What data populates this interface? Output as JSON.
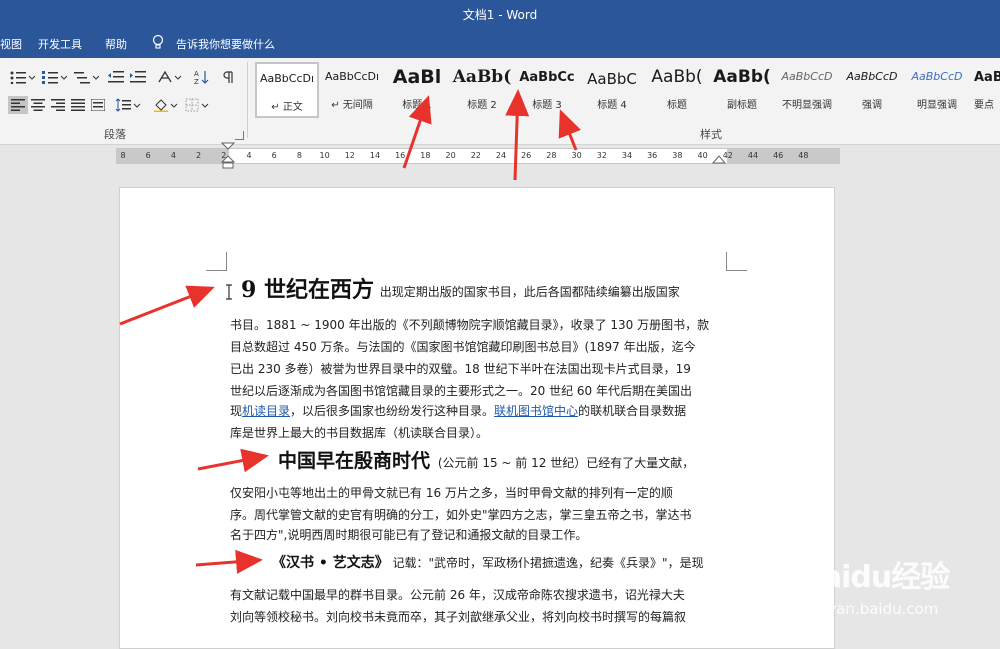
{
  "window": {
    "title": "文档1  -  Word"
  },
  "menu": {
    "tabs": [
      {
        "label": "视图"
      },
      {
        "label": "开发工具"
      },
      {
        "label": "帮助"
      },
      {
        "label": "告诉我你想要做什么"
      }
    ]
  },
  "ribbon": {
    "paragraph_group_label": "段落",
    "styles_group_label": "样式",
    "styles": [
      {
        "sample": "AaBbCcDı",
        "name": "↵ 正文",
        "selected": true
      },
      {
        "sample": "AaBbCcDı",
        "name": "↵ 无间隔"
      },
      {
        "sample": "AaBl",
        "name": "标题 1"
      },
      {
        "sample": "AaBb(",
        "name": "标题 2"
      },
      {
        "sample": "AaBbCc",
        "name": "标题 3"
      },
      {
        "sample": "AaBbC",
        "name": "标题 4"
      },
      {
        "sample": "AaBb(",
        "name": "标题"
      },
      {
        "sample": "AaBb(",
        "name": "副标题"
      },
      {
        "sample": "AaBbCcD",
        "name": "不明显强调"
      },
      {
        "sample": "AaBbCcD",
        "name": "强调"
      },
      {
        "sample": "AaBbCcD",
        "name": "明显强调"
      },
      {
        "sample": "AaBI",
        "name": "要点"
      }
    ]
  },
  "ruler": {
    "ticks": [
      "8",
      "6",
      "4",
      "2",
      "2",
      "4",
      "6",
      "8",
      "10",
      "12",
      "14",
      "16",
      "18",
      "20",
      "22",
      "24",
      "26",
      "28",
      "30",
      "32",
      "34",
      "36",
      "38",
      "40",
      "42",
      "44",
      "46",
      "48"
    ]
  },
  "document": {
    "paragraphs": [
      {
        "heading": "9 世纪在西方",
        "lines": [
          "出现定期出版的国家书目，此后各国都陆续编纂出版国家",
          "书目。1881 ~ 1900 年出版的《不列颠博物院字顺馆藏目录》，收录了 130 万册图书，款",
          "目总数超过 450 万条。与法国的《国家图书馆馆藏印刷图书总目》(1897 年出版，迄今",
          "已出 230 多卷）被誉为世界目录中的双璧。18 世纪下半叶在法国出现卡片式目录，19",
          "世纪以后逐渐成为各国图书馆馆藏目录的主要形式之一。20 世纪 60 年代后期在美国出",
          "库是世界上最大的书目数据库（机读联合目录）。"
        ],
        "line6_a": "现",
        "link1": "机读目录",
        "line6_b": "，以后很多国家也纷纷发行这种目录。",
        "link2": "联机图书馆中心",
        "line6_c": "的联机联合目录数据"
      },
      {
        "heading": "中国早在殷商时代",
        "lines": [
          "(公元前 15 ~ 前 12 世纪）已经有了大量文献，",
          "仅安阳小屯等地出土的甲骨文就已有 16 万片之多，当时甲骨文献的排列有一定的顺",
          "序。周代掌管文献的史官有明确的分工，如外史\"掌四方之志，掌三皇五帝之书，掌达书",
          "名于四方\",说明西周时期很可能已有了登记和通报文献的目录工作。"
        ]
      },
      {
        "heading": "《汉书 • 艺文志》",
        "lines": [
          "记载：\"武帝时，军政杨仆捃摭遗逸，纪奏《兵录》\"，是现",
          "有文献记载中国最早的群书目录。公元前 26 年，汉成帝命陈农搜求遗书，诏光禄大夫",
          "刘向等领校秘书。刘向校书未竟而卒，其子刘歆继承父业，将刘向校书时撰写的每篇叙"
        ]
      }
    ]
  },
  "watermark": {
    "brand": "Baidu经验",
    "url": "jingyan.baidu.com"
  }
}
